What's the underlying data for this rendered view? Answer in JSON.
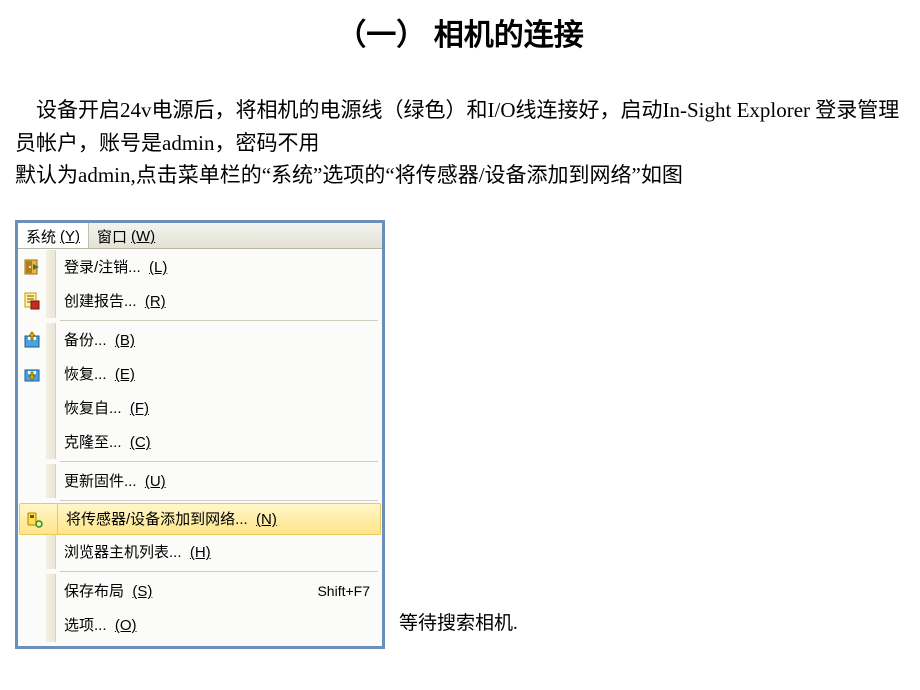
{
  "title": "（一） 相机的连接",
  "paragraph": {
    "line1": "设备开启24v电源后，将相机的电源线（绿色）和I/O线连接好，启动In-Sight Explorer 登录管理员帐户，账号是admin，密码不用",
    "line2": "默认为admin,点击菜单栏的“系统”选项的“将传感器/设备添加到网络”如图"
  },
  "menubar": {
    "system": {
      "label": "系统",
      "accel": "(Y)"
    },
    "window": {
      "label": "窗口",
      "accel": "(W)"
    }
  },
  "menu": {
    "login": {
      "label": "登录/注销...",
      "accel": "(L)"
    },
    "report": {
      "label": "创建报告...",
      "accel": "(R)"
    },
    "backup": {
      "label": "备份...",
      "accel": "(B)"
    },
    "restore": {
      "label": "恢复...",
      "accel": "(E)"
    },
    "restoreFrom": {
      "label": "恢复自...",
      "accel": "(F)"
    },
    "cloneTo": {
      "label": "克隆至...",
      "accel": "(C)"
    },
    "updateFw": {
      "label": "更新固件...",
      "accel": "(U)"
    },
    "addNetwork": {
      "label": "将传感器/设备添加到网络...",
      "accel": "(N)"
    },
    "browserHost": {
      "label": "浏览器主机列表...",
      "accel": "(H)"
    },
    "saveLayout": {
      "label": "保存布局",
      "accel": "(S)",
      "shortcut": "Shift+F7"
    },
    "options": {
      "label": "选项...",
      "accel": "(O)"
    }
  },
  "footer": "等待搜索相机."
}
